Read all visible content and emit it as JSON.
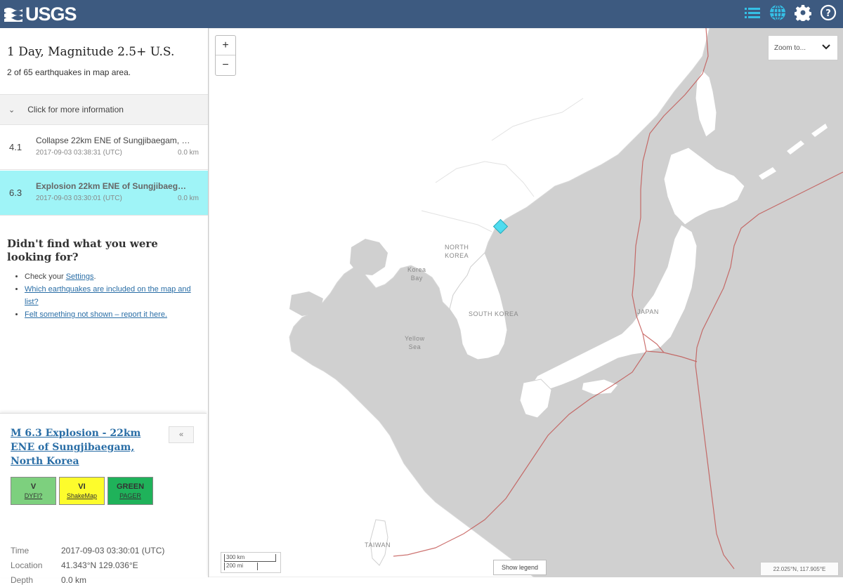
{
  "header": {
    "logo_text": "USGS",
    "icons": [
      "list-icon",
      "globe-icon",
      "gear-icon",
      "help-icon"
    ],
    "bg_color": "#3d5a80",
    "accent_color": "#35c0e6"
  },
  "sidebar": {
    "title": "1 Day, Magnitude 2.5+ U.S.",
    "count_text": "2 of 65 earthquakes in map area.",
    "info_toggle": "Click for more information",
    "earthquakes": [
      {
        "mag": "4.1",
        "title": "Collapse 22km ENE of Sungjibaegam, …",
        "time": "2017-09-03 03:38:31 (UTC)",
        "depth": "0.0 km",
        "selected": false
      },
      {
        "mag": "6.3",
        "title": "Explosion 22km ENE of Sungjibaeg…",
        "time": "2017-09-03 03:30:01 (UTC)",
        "depth": "0.0 km",
        "selected": true
      }
    ],
    "help": {
      "heading": "Didn't find what you were looking for?",
      "item1_prefix": "Check your ",
      "item1_link": "Settings",
      "item1_suffix": ".",
      "item2_link": "Which earthquakes are included on the map and list?",
      "item3_link": "Felt something not shown – report it here."
    }
  },
  "card": {
    "title": "M 6.3 Explosion - 22km ENE of Sungjibaegam, North Korea",
    "close_label": "«",
    "badges": [
      {
        "level": "V",
        "label": "DYFI?",
        "color": "#7dd07e"
      },
      {
        "level": "VI",
        "label": "ShakeMap",
        "color": "#fdfc2c"
      },
      {
        "level": "GREEN",
        "label": "PAGER",
        "color": "#1fb25a"
      }
    ],
    "time_label": "Time",
    "time_value": "2017-09-03 03:30:01 (UTC)",
    "location_label": "Location",
    "location_value": "41.343°N 129.036°E",
    "depth_label": "Depth",
    "depth_value": "0.0 km"
  },
  "map": {
    "zoom_in": "+",
    "zoom_out": "−",
    "zoom_select": "Zoom to...",
    "labels": {
      "north_korea": "NORTH\nKOREA",
      "south_korea": "SOUTH KOREA",
      "japan": "JAPAN",
      "korea_bay": "Korea\nBay",
      "yellow_sea": "Yellow\nSea",
      "taiwan": "TAIWAN"
    },
    "scale_km": "300 km",
    "scale_mi": "200 mi",
    "legend_button": "Show legend",
    "coords": "22.025°N, 117.905°E",
    "land_color": "#ffffff",
    "water_color": "#d0d0d0",
    "fault_color": "#c0504d"
  }
}
